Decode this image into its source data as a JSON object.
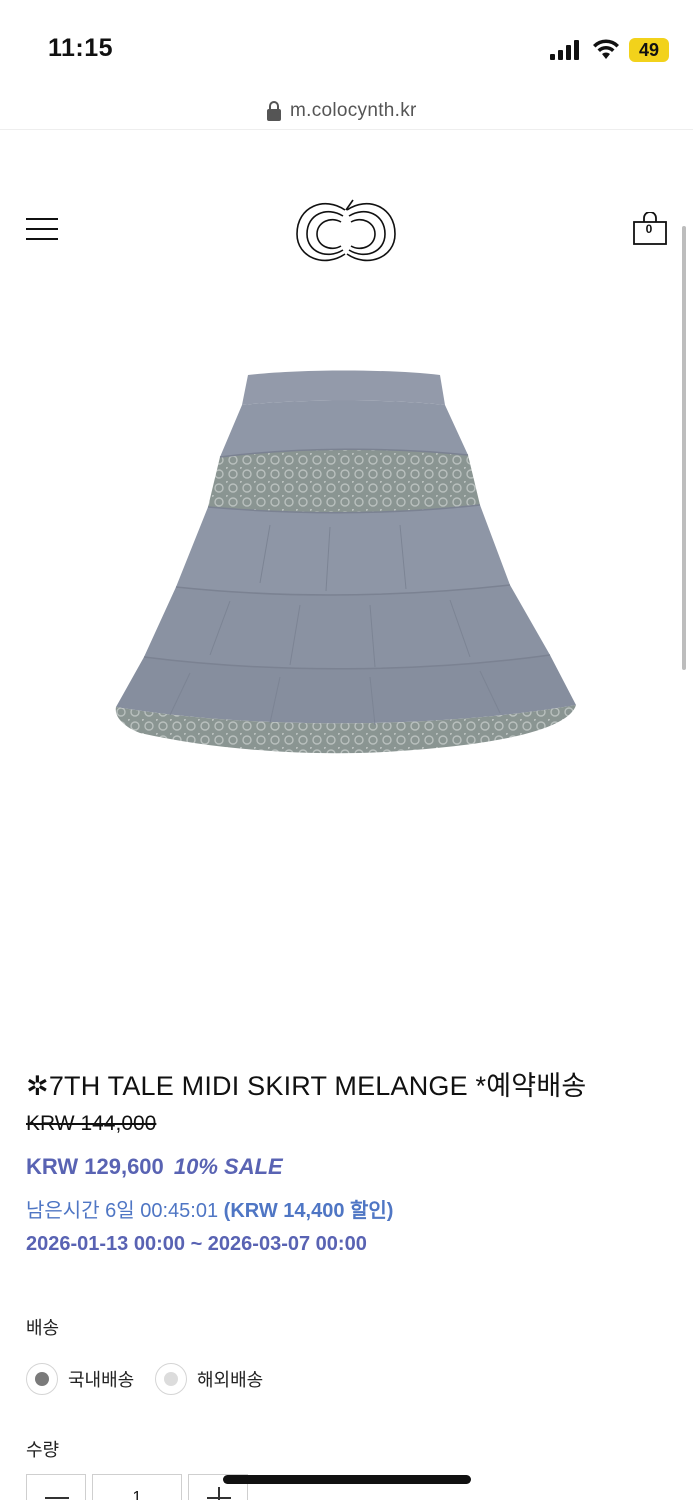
{
  "status_bar": {
    "time": "11:15",
    "battery": "49"
  },
  "browser": {
    "url": "m.colocynth.kr"
  },
  "header": {
    "cart_count": "0"
  },
  "product": {
    "title": "✲7TH TALE MIDI SKIRT MELANGE *예약배송",
    "price_original": "KRW 144,000",
    "price_sale": "KRW 129,600",
    "sale_tag": "10% SALE",
    "countdown_label": "남은시간 6일 00:45:01",
    "discount_amount": "(KRW 14,400 할인)",
    "sale_period": "2026-01-13 00:00 ~ 2026-03-07 00:00",
    "image_alt": "grey melange tiered midi skirt with lace"
  },
  "options": {
    "shipping_label": "배송",
    "shipping_choices": [
      {
        "label": "국내배송",
        "selected": true
      },
      {
        "label": "해외배송",
        "selected": false
      }
    ],
    "quantity_label": "수량",
    "quantity_value": "1"
  },
  "colors": {
    "sale_price": "#5963b3",
    "countdown": "#4f76c4",
    "skirt_body": "#8f97a7",
    "skirt_lace": "#7e8a88"
  }
}
